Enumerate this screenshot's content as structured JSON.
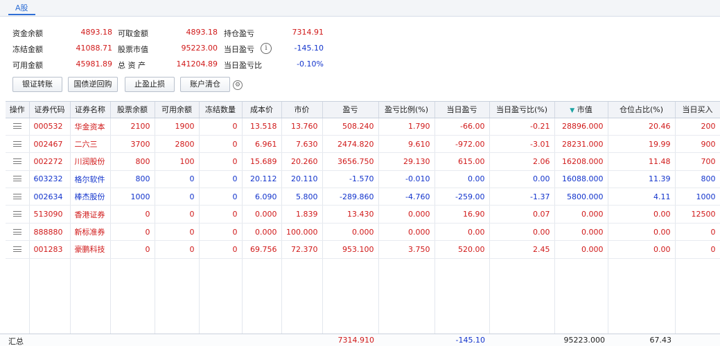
{
  "tab": {
    "label": "A股"
  },
  "summary": {
    "funds_balance": {
      "label": "资金余额",
      "value": "4893.18"
    },
    "withdrawable": {
      "label": "可取金额",
      "value": "4893.18"
    },
    "position_pnl": {
      "label": "持仓盈亏",
      "value": "7314.91"
    },
    "frozen": {
      "label": "冻结金额",
      "value": "41088.71"
    },
    "market_value": {
      "label": "股票市值",
      "value": "95223.00"
    },
    "today_pnl": {
      "label": "当日盈亏",
      "value": "-145.10"
    },
    "available": {
      "label": "可用金额",
      "value": "45981.89"
    },
    "total_assets": {
      "label": "总 资 产",
      "value": "141204.89"
    },
    "today_pnl_ratio": {
      "label": "当日盈亏比",
      "value": "-0.10%"
    }
  },
  "buttons": {
    "bank_transfer": "银证转账",
    "bond_repo": "国债逆回购",
    "stop_loss": "止盈止损",
    "clear_account": "账户清仓"
  },
  "colors": {
    "red": "#d01818",
    "blue": "#1133cc",
    "accent": "#2f6fd6"
  },
  "table": {
    "headers": [
      "操作",
      "证券代码",
      "证券名称",
      "股票余额",
      "可用余额",
      "冻结数量",
      "成本价",
      "市价",
      "盈亏",
      "盈亏比例(%)",
      "当日盈亏",
      "当日盈亏比(%)",
      "市值",
      "仓位占比(%)",
      "当日买入"
    ],
    "sort_indicator": "▼",
    "rows": [
      {
        "color": "red",
        "cells": [
          "000532",
          "华金资本",
          "2100",
          "1900",
          "0",
          "13.518",
          "13.760",
          "508.240",
          "1.790",
          "-66.00",
          "-0.21",
          "28896.000",
          "20.46",
          "200"
        ]
      },
      {
        "color": "red",
        "cells": [
          "002467",
          "二六三",
          "3700",
          "2800",
          "0",
          "6.961",
          "7.630",
          "2474.820",
          "9.610",
          "-972.00",
          "-3.01",
          "28231.000",
          "19.99",
          "900"
        ]
      },
      {
        "color": "red",
        "cells": [
          "002272",
          "川润股份",
          "800",
          "100",
          "0",
          "15.689",
          "20.260",
          "3656.750",
          "29.130",
          "615.00",
          "2.06",
          "16208.000",
          "11.48",
          "700"
        ]
      },
      {
        "color": "blue",
        "cells": [
          "603232",
          "格尔软件",
          "800",
          "0",
          "0",
          "20.112",
          "20.110",
          "-1.570",
          "-0.010",
          "0.00",
          "0.00",
          "16088.000",
          "11.39",
          "800"
        ]
      },
      {
        "color": "blue",
        "cells": [
          "002634",
          "棒杰股份",
          "1000",
          "0",
          "0",
          "6.090",
          "5.800",
          "-289.860",
          "-4.760",
          "-259.00",
          "-1.37",
          "5800.000",
          "4.11",
          "1000"
        ]
      },
      {
        "color": "red",
        "cells": [
          "513090",
          "香港证券",
          "0",
          "0",
          "0",
          "0.000",
          "1.839",
          "13.430",
          "0.000",
          "16.90",
          "0.07",
          "0.000",
          "0.00",
          "12500"
        ]
      },
      {
        "color": "red",
        "cells": [
          "888880",
          "新标准券",
          "0",
          "0",
          "0",
          "0.000",
          "100.000",
          "0.000",
          "0.000",
          "0.00",
          "0.00",
          "0.000",
          "0.00",
          "0"
        ]
      },
      {
        "color": "red",
        "cells": [
          "001283",
          "豪鹏科技",
          "0",
          "0",
          "0",
          "69.756",
          "72.370",
          "953.100",
          "3.750",
          "520.00",
          "2.45",
          "0.000",
          "0.00",
          "0"
        ]
      }
    ]
  },
  "footer": {
    "label": "汇总",
    "pnl": "7314.910",
    "today_pnl": "-145.10",
    "market_value": "95223.000",
    "position_ratio": "67.43"
  }
}
